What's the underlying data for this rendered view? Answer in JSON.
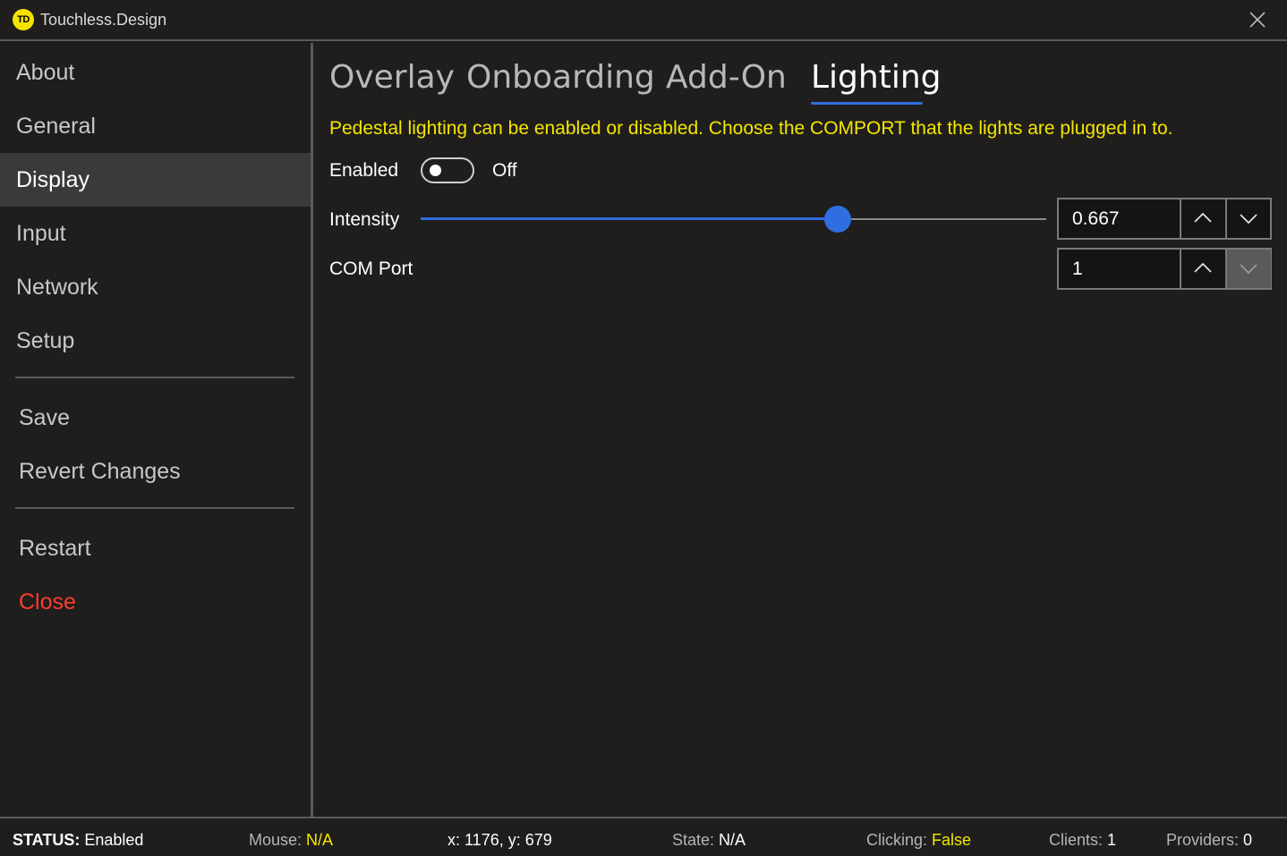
{
  "app": {
    "title": "Touchless.Design",
    "logo_text": "TD"
  },
  "sidebar": {
    "items": [
      {
        "label": "About"
      },
      {
        "label": "General"
      },
      {
        "label": "Display"
      },
      {
        "label": "Input"
      },
      {
        "label": "Network"
      },
      {
        "label": "Setup"
      }
    ],
    "active": "Display",
    "actions": {
      "save": "Save",
      "revert": "Revert Changes",
      "restart": "Restart",
      "close": "Close"
    }
  },
  "tabs": [
    {
      "label": "Overlay"
    },
    {
      "label": "Onboarding"
    },
    {
      "label": "Add-On"
    },
    {
      "label": "Lighting"
    }
  ],
  "active_tab": "Lighting",
  "lighting": {
    "info": "Pedestal lighting can be enabled or disabled. Choose the COMPORT that the lights are plugged in to.",
    "enabled_label": "Enabled",
    "enabled_state": "Off",
    "intensity_label": "Intensity",
    "intensity_value": "0.667",
    "intensity_fraction": 0.667,
    "comport_label": "COM Port",
    "comport_value": "1"
  },
  "colors": {
    "accent": "#2f6de0",
    "warning_text": "#f5e600",
    "close_red": "#ff3b30"
  },
  "status": {
    "status_label": "STATUS:",
    "status_value": "Enabled",
    "mouse_label": "Mouse:",
    "mouse_value": "N/A",
    "coords": "x: 1176, y:  679",
    "state_label": "State:",
    "state_value": "N/A",
    "clicking_label": "Clicking:",
    "clicking_value": "False",
    "clients_label": "Clients:",
    "clients_value": "1",
    "providers_label": "Providers:",
    "providers_value": "0"
  }
}
